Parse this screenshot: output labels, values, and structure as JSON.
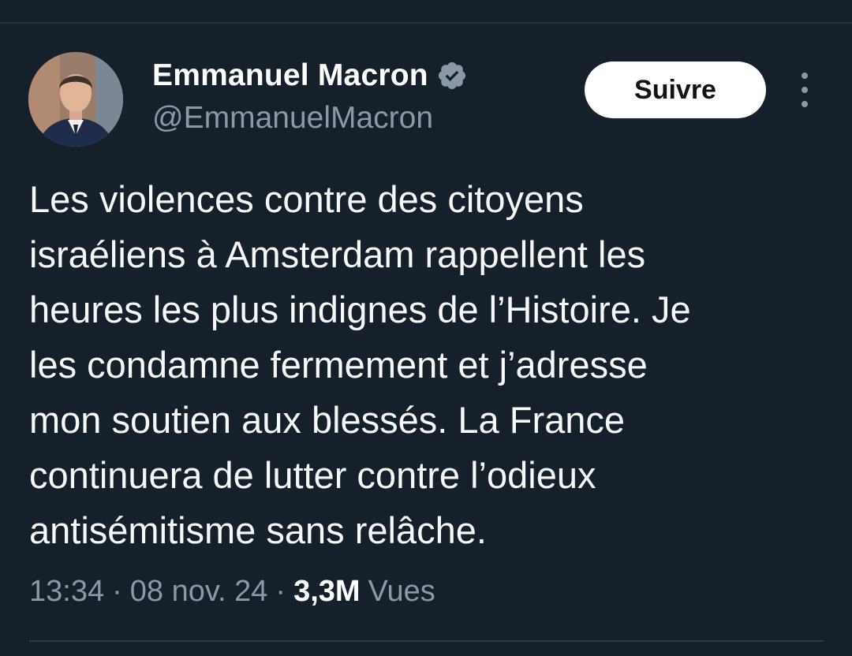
{
  "author": {
    "display_name": "Emmanuel Macron",
    "handle": "@EmmanuelMacron",
    "verified": true,
    "avatar_icon": "profile-photo"
  },
  "actions": {
    "follow_label": "Suivre",
    "more_icon": "vertical-ellipsis-icon"
  },
  "tweet": {
    "lines": [
      "Les violences contre des citoyens",
      "israéliens à Amsterdam rappellent les",
      "heures les plus indignes de l’Histoire. Je",
      "les condamne fermement et j’adresse",
      "mon soutien aux blessés. La France",
      "continuera de lutter contre l’odieux",
      "antisémitisme sans relâche."
    ]
  },
  "meta": {
    "time": "13:34",
    "separator": "·",
    "date": "08 nov. 24",
    "views_count": "3,3M",
    "views_label": "Vues"
  },
  "colors": {
    "background": "#15202b",
    "text": "#f7f9f9",
    "secondary_text": "#8b98a5",
    "verified_badge": "#8b98a5",
    "follow_button_bg": "#ffffff",
    "follow_button_text": "#0f1419"
  }
}
